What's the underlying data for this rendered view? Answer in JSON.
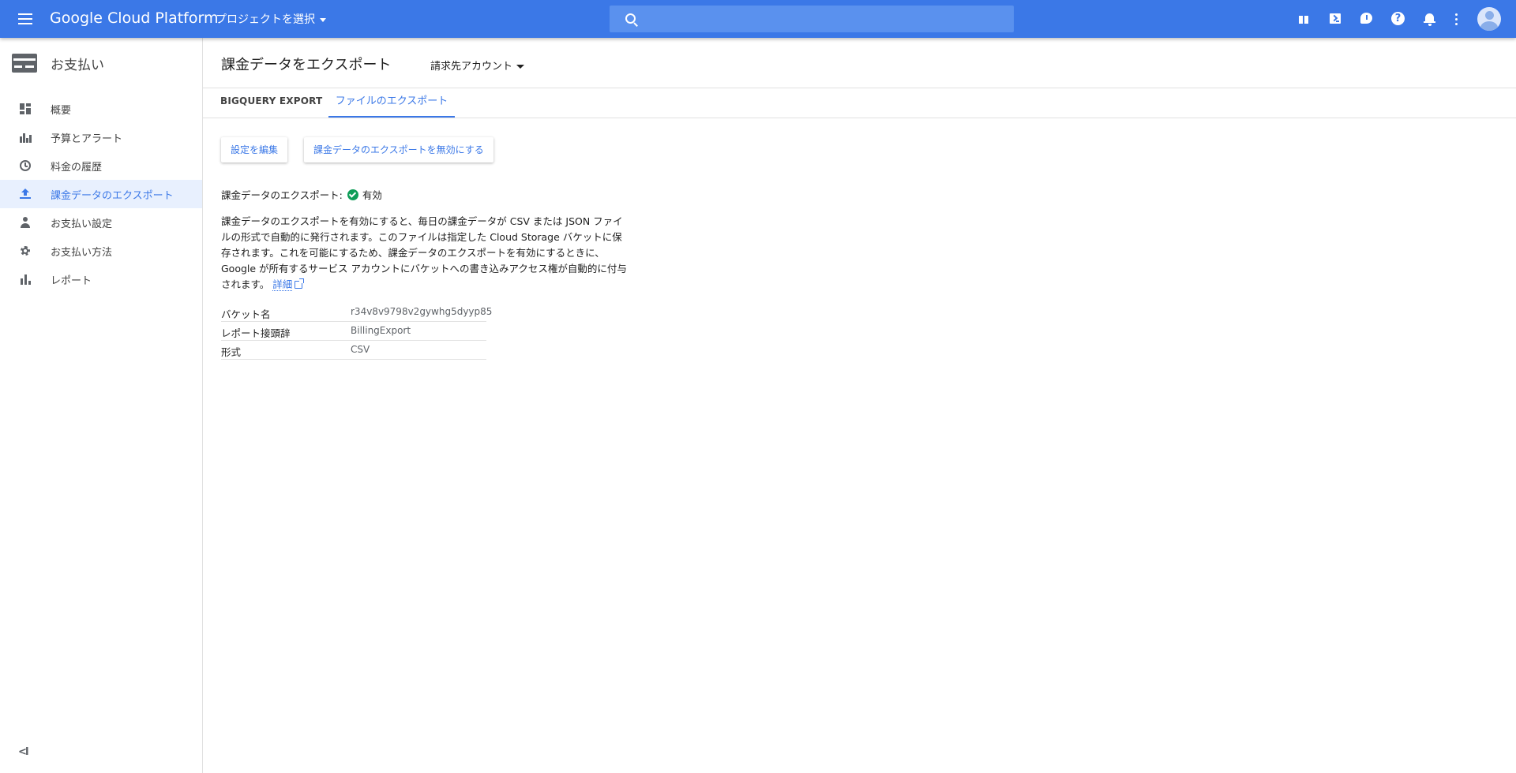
{
  "topbar": {
    "title": "Google Cloud Platform",
    "project_selector": "プロジェクトを選択",
    "search_placeholder": "",
    "help_glyph": "?",
    "accent_color": "#3b78e7"
  },
  "sidebar": {
    "title": "お支払い",
    "items": [
      {
        "label": "概要",
        "icon": "dashboard-icon",
        "active": false
      },
      {
        "label": "予算とアラート",
        "icon": "bar-chart-icon",
        "active": false
      },
      {
        "label": "料金の履歴",
        "icon": "clock-icon",
        "active": false
      },
      {
        "label": "課金データのエクスポート",
        "icon": "upload-icon",
        "active": true
      },
      {
        "label": "お支払い設定",
        "icon": "person-icon",
        "active": false
      },
      {
        "label": "お支払い方法",
        "icon": "gear-icon",
        "active": false
      },
      {
        "label": "レポート",
        "icon": "bar-chart-icon",
        "active": false
      }
    ],
    "collapse_label": "<I"
  },
  "main": {
    "title": "課金データをエクスポート",
    "account_dropdown": "請求先アカウント",
    "tabs": [
      {
        "label": "BIGQUERY EXPORT",
        "active": false
      },
      {
        "label": "ファイルのエクスポート",
        "active": true
      }
    ],
    "buttons": {
      "edit": "設定を編集",
      "disable": "課金データのエクスポートを無効にする"
    },
    "status": {
      "label": "課金データのエクスポート:",
      "value": "有効",
      "color": "#0f9d58"
    },
    "description": "課金データのエクスポートを有効にすると、毎日の課金データが CSV または JSON ファイルの形式で自動的に発行されます。このファイルは指定した Cloud Storage バケットに保存されます。これを可能にするため、課金データのエクスポートを有効にするときに、Google が所有するサービス アカウントにバケットへの書き込みアクセス権が自動的に付与されます。",
    "learn_more": "詳細",
    "details": [
      {
        "key": "バケット名",
        "value": "r34v8v9798v2gywhg5dyyp85"
      },
      {
        "key": "レポート接頭辞",
        "value": "BillingExport"
      },
      {
        "key": "形式",
        "value": "CSV"
      }
    ]
  }
}
